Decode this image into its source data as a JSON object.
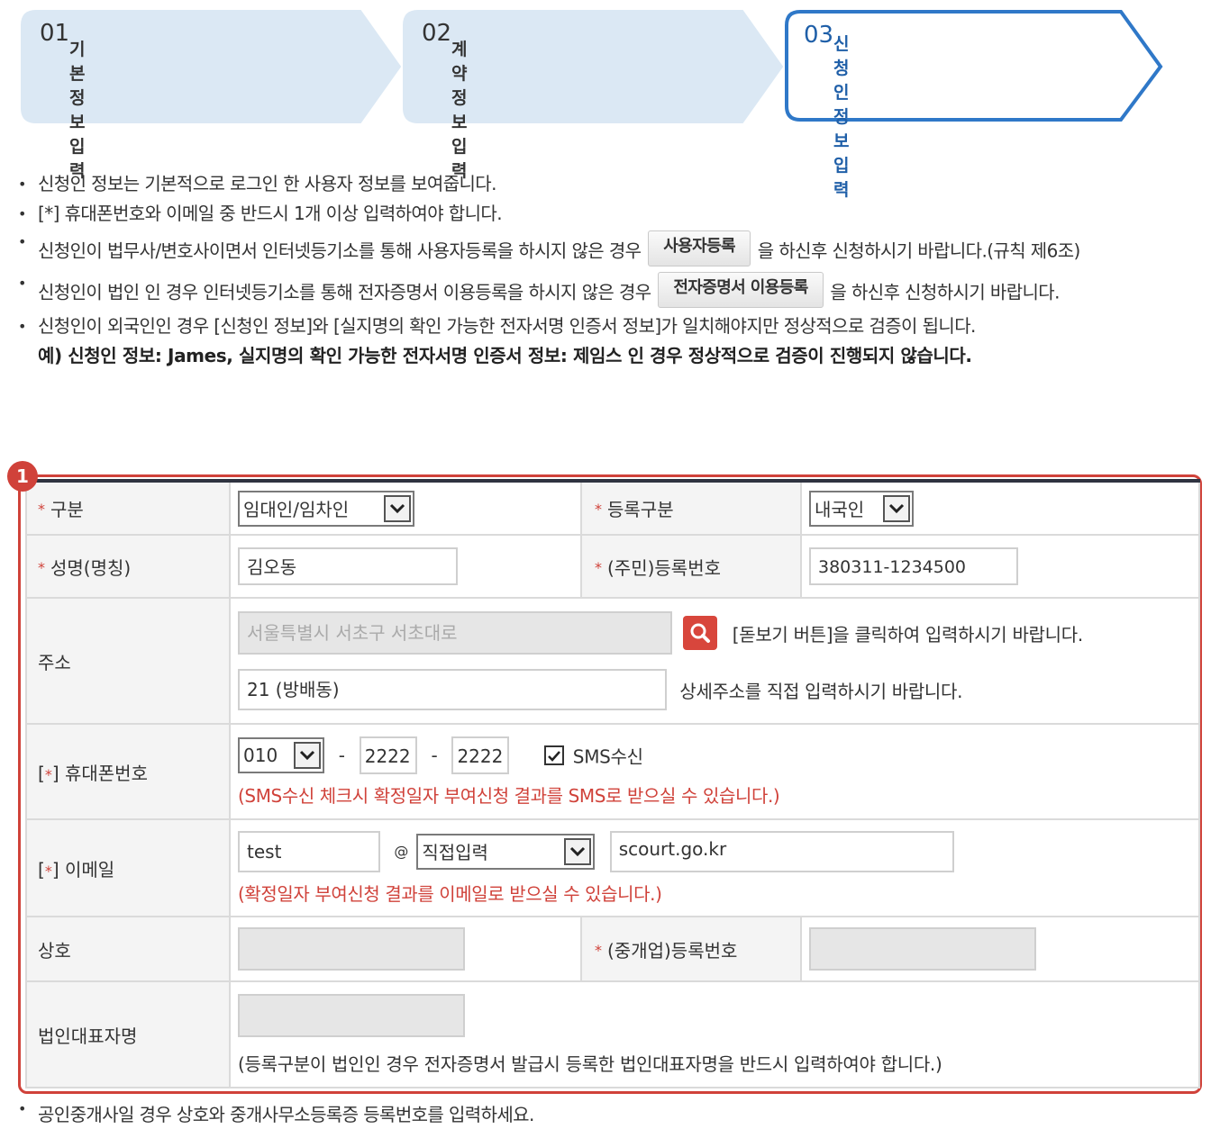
{
  "steps": [
    {
      "num": "01",
      "title": "기본정보 입력",
      "active": false
    },
    {
      "num": "02",
      "title": "계약정보 입력",
      "active": false
    },
    {
      "num": "03",
      "title": "신청인정보 입력",
      "active": true
    }
  ],
  "notes": {
    "n1": "신청인 정보는 기본적으로 로그인 한 사용자 정보를 보여줍니다.",
    "n2": "[*] 휴대폰번호와 이메일 중 반드시 1개 이상 입력하여야 합니다.",
    "n3_pre": "신청인이 법무사/변호사이면서 인터넷등기소를 통해 사용자등록을 하시지 않은 경우",
    "n3_btn": "사용자등록",
    "n3_post": "을 하신후 신청하시기 바랍니다.(규칙 제6조)",
    "n4_pre": "신청인이 법인 인 경우 인터넷등기소를 통해 전자증명서 이용등록을 하시지 않은 경우",
    "n4_btn": "전자증명서 이용등록",
    "n4_post": "을 하신후 신청하시기 바랍니다.",
    "n5": "신청인이 외국인인 경우 [신청인 정보]와 [실지명의 확인 가능한 전자서명 인증서 정보]가 일치해야지만 정상적으로 검증이 됩니다.",
    "n6": "예) 신청인 정보: James, 실지명의 확인 가능한 전자서명 인증서 정보: 제임스 인 경우 정상적으로 검증이 진행되지 않습니다."
  },
  "badge": "1",
  "form": {
    "req_mark": "*",
    "type_label": "구분",
    "type_value": "임대인/임차인",
    "regtype_label": "등록구분",
    "regtype_value": "내국인",
    "name_label": "성명(명칭)",
    "name_value": "김오동",
    "idnum_label": "(주민)등록번호",
    "idnum_value": "380311-1234500",
    "addr_label": "주소",
    "addr_value": "서울특별시 서초구 서초대로",
    "addr_help": "[돋보기 버튼]을 클릭하여 입력하시기 바랍니다.",
    "addr_detail": "21 (방배동)",
    "addr_detail_help": "상세주소를 직접 입력하시기 바랍니다.",
    "phone_label_prefix": "[",
    "phone_label_suffix": "] 휴대폰번호",
    "phone_1": "010",
    "phone_2": "2222",
    "phone_3": "2222",
    "phone_dash": "-",
    "sms_label": "SMS수신",
    "sms_checked": true,
    "phone_note": "(SMS수신 체크시 확정일자 부여신청 결과를 SMS로 받으실 수 있습니다.)",
    "email_label_prefix": "[",
    "email_label_suffix": "] 이메일",
    "email_id": "test",
    "email_at": "@",
    "email_select": "직접입력",
    "email_domain": "scourt.go.kr",
    "email_note": "(확정일자 부여신청 결과를 이메일로 받으실 수 있습니다.)",
    "company_label": "상호",
    "broker_label": "(중개업)등록번호",
    "rep_label": "법인대표자명",
    "rep_note": "(등록구분이 법인인 경우 전자증명서 발급시 등록한 법인대표자명을 반드시 입력하여야 합니다.)"
  },
  "footnote": "공인중개사일 경우 상호와 중개사무소등록증 등록번호를 입력하세요.",
  "colors": {
    "accent": "#1f5fa8",
    "required": "#d0423a",
    "step_bg": "#dbe8f4",
    "header_bar": "#2f3340"
  }
}
